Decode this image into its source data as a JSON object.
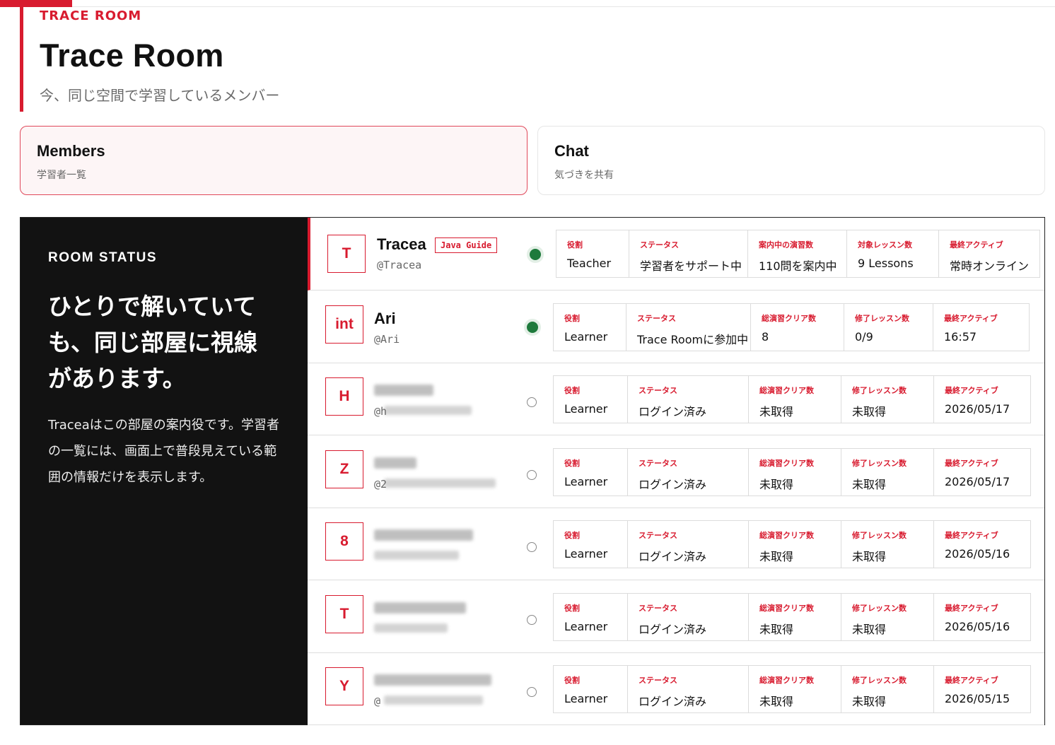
{
  "header": {
    "eyebrow": "TRACE ROOM",
    "title": "Trace Room",
    "subtitle": "今、同じ空間で学習しているメンバー"
  },
  "tabs": [
    {
      "title": "Members",
      "sub": "学習者一覧"
    },
    {
      "title": "Chat",
      "sub": "気づきを共有"
    }
  ],
  "status": {
    "label": "ROOM STATUS",
    "headline": "ひとりで解いていても、同じ部屋に視線があります。",
    "desc": "Traceaはこの部屋の案内役です。学習者の一覧には、画面上で普段見えている範囲の情報だけを表示します。"
  },
  "members": [
    {
      "avatar": "T",
      "name": "Tracea",
      "handle": "@Tracea",
      "badge": "Java Guide",
      "online": true,
      "stats": [
        {
          "k": "役割",
          "v": "Teacher"
        },
        {
          "k": "ステータス",
          "v": "学習者をサポート中"
        },
        {
          "k": "案内中の演習数",
          "v": "110問を案内中"
        },
        {
          "k": "対象レッスン数",
          "v": "9 Lessons"
        },
        {
          "k": "最終アクティブ",
          "v": "常時オンライン"
        }
      ]
    },
    {
      "avatar": "int",
      "name": "Ari",
      "handle": "@Ari",
      "online": true,
      "stats": [
        {
          "k": "役割",
          "v": "Learner"
        },
        {
          "k": "ステータス",
          "v": "Trace Roomに参加中"
        },
        {
          "k": "総演習クリア数",
          "v": "8"
        },
        {
          "k": "修了レッスン数",
          "v": "0/9"
        },
        {
          "k": "最終アクティブ",
          "v": "16:57"
        }
      ]
    },
    {
      "avatar": "H",
      "name": "",
      "handle": "@h",
      "online": false,
      "stats": [
        {
          "k": "役割",
          "v": "Learner"
        },
        {
          "k": "ステータス",
          "v": "ログイン済み"
        },
        {
          "k": "総演習クリア数",
          "v": "未取得"
        },
        {
          "k": "修了レッスン数",
          "v": "未取得"
        },
        {
          "k": "最終アクティブ",
          "v": "2026/05/17"
        }
      ]
    },
    {
      "avatar": "Z",
      "name": "",
      "handle": "@2",
      "online": false,
      "stats": [
        {
          "k": "役割",
          "v": "Learner"
        },
        {
          "k": "ステータス",
          "v": "ログイン済み"
        },
        {
          "k": "総演習クリア数",
          "v": "未取得"
        },
        {
          "k": "修了レッスン数",
          "v": "未取得"
        },
        {
          "k": "最終アクティブ",
          "v": "2026/05/17"
        }
      ]
    },
    {
      "avatar": "8",
      "name": "",
      "handle": "",
      "online": false,
      "stats": [
        {
          "k": "役割",
          "v": "Learner"
        },
        {
          "k": "ステータス",
          "v": "ログイン済み"
        },
        {
          "k": "総演習クリア数",
          "v": "未取得"
        },
        {
          "k": "修了レッスン数",
          "v": "未取得"
        },
        {
          "k": "最終アクティブ",
          "v": "2026/05/16"
        }
      ]
    },
    {
      "avatar": "T",
      "name": "",
      "handle": "",
      "online": false,
      "stats": [
        {
          "k": "役割",
          "v": "Learner"
        },
        {
          "k": "ステータス",
          "v": "ログイン済み"
        },
        {
          "k": "総演習クリア数",
          "v": "未取得"
        },
        {
          "k": "修了レッスン数",
          "v": "未取得"
        },
        {
          "k": "最終アクティブ",
          "v": "2026/05/16"
        }
      ]
    },
    {
      "avatar": "Y",
      "name": "",
      "handle": "@",
      "online": false,
      "stats": [
        {
          "k": "役割",
          "v": "Learner"
        },
        {
          "k": "ステータス",
          "v": "ログイン済み"
        },
        {
          "k": "総演習クリア数",
          "v": "未取得"
        },
        {
          "k": "修了レッスン数",
          "v": "未取得"
        },
        {
          "k": "最終アクティブ",
          "v": "2026/05/15"
        }
      ]
    }
  ]
}
